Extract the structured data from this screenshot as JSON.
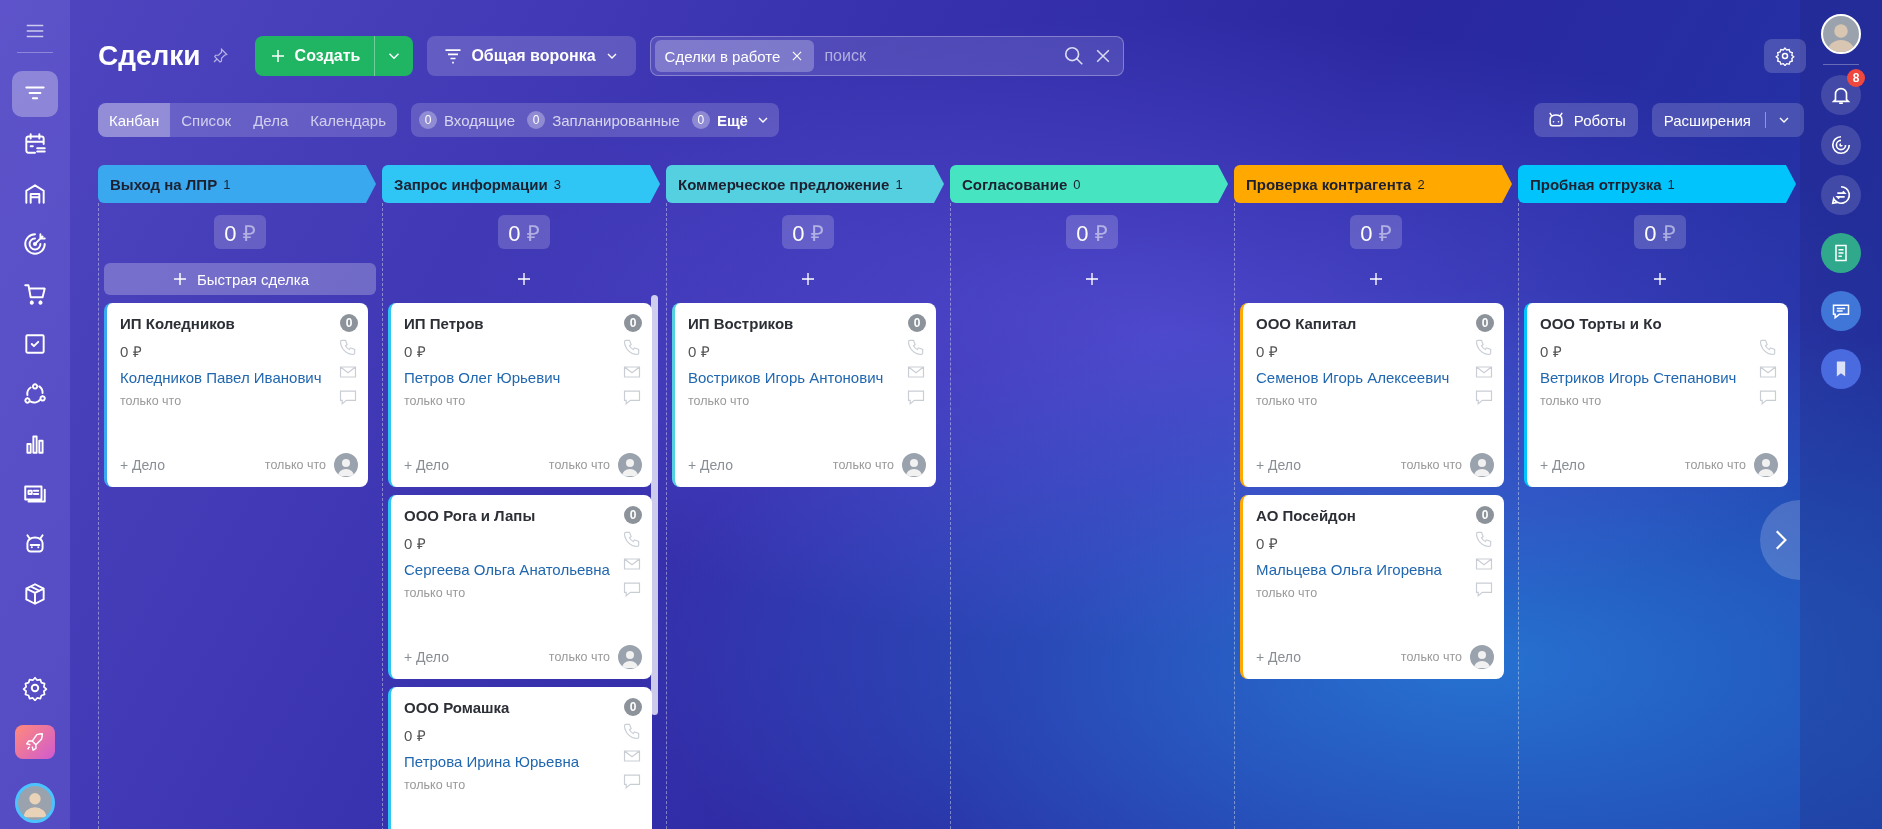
{
  "sidebar": {
    "items": [
      {
        "selected": true
      },
      {
        "selected": false
      },
      {
        "selected": false
      },
      {
        "selected": false
      },
      {
        "selected": false
      },
      {
        "selected": false
      },
      {
        "selected": false
      },
      {
        "selected": false
      },
      {
        "selected": false
      },
      {
        "selected": false
      },
      {
        "selected": false
      }
    ]
  },
  "header": {
    "title": "Сделки",
    "create_button": "Создать",
    "funnel_button": "Общая воронка",
    "search": {
      "filter_tag": "Сделки в работе",
      "placeholder": "поиск"
    }
  },
  "view_tabs": [
    {
      "label": "Канбан",
      "selected": true
    },
    {
      "label": "Список",
      "selected": false
    },
    {
      "label": "Дела",
      "selected": false
    },
    {
      "label": "Календарь",
      "selected": false
    }
  ],
  "counters": [
    {
      "count": "0",
      "label": "Входящие"
    },
    {
      "count": "0",
      "label": "Запланированные"
    },
    {
      "count": "0",
      "label": "Ещё"
    }
  ],
  "robots_button": "Роботы",
  "extensions_button": "Расширения",
  "notifications_badge": "8",
  "columns": [
    {
      "title": "Выход на ЛПР",
      "count": "1",
      "color": "#3aa8ef",
      "sum": "0",
      "currency": "₽",
      "quick_add_label": "Быстрая сделка",
      "cards": [
        {
          "title": "ИП Коледников",
          "counter": "0",
          "amount": "0 ₽",
          "contact": "Коледников Павел Иванович",
          "created": "только что",
          "add_task": "+ Дело",
          "updated": "только что"
        }
      ]
    },
    {
      "title": "Запрос информации",
      "count": "3",
      "color": "#2fc6f6",
      "sum": "0",
      "currency": "₽",
      "cards": [
        {
          "title": "ИП Петров",
          "counter": "0",
          "amount": "0 ₽",
          "contact": "Петров Олег Юрьевич",
          "created": "только что",
          "add_task": "+ Дело",
          "updated": "только что"
        },
        {
          "title": "ООО Рога и Лапы",
          "counter": "0",
          "amount": "0 ₽",
          "contact": "Сергеева Ольга Анатольевна",
          "created": "только что",
          "add_task": "+ Дело",
          "updated": "только что"
        },
        {
          "title": "ООО Ромашка",
          "counter": "0",
          "amount": "0 ₽",
          "contact": "Петрова Ирина Юрьевна",
          "created": "только что"
        }
      ]
    },
    {
      "title": "Коммерческое предложение",
      "count": "1",
      "color": "#55d0e0",
      "sum": "0",
      "currency": "₽",
      "cards": [
        {
          "title": "ИП Востриков",
          "counter": "0",
          "amount": "0 ₽",
          "contact": "Востриков Игорь Антонович",
          "created": "только что",
          "add_task": "+ Дело",
          "updated": "только что"
        }
      ]
    },
    {
      "title": "Согласование",
      "count": "0",
      "color": "#47e4c2",
      "sum": "0",
      "currency": "₽"
    },
    {
      "title": "Проверка контрагента",
      "count": "2",
      "color": "#ffa900",
      "sum": "0",
      "currency": "₽",
      "cards": [
        {
          "title": "ООО Капитал",
          "counter": "0",
          "amount": "0 ₽",
          "contact": "Семенов Игорь Алексеевич",
          "created": "только что",
          "add_task": "+ Дело",
          "updated": "только что"
        },
        {
          "title": "АО Посейдон",
          "counter": "0",
          "amount": "0 ₽",
          "contact": "Мальцева Ольга Игоревна",
          "created": "только что",
          "add_task": "+ Дело",
          "updated": "только что"
        }
      ]
    },
    {
      "title": "Пробная отгрузка",
      "count": "1",
      "color": "#00c4fb",
      "sum": "0",
      "currency": "₽",
      "cards": [
        {
          "title": "ООО Торты и Ко",
          "amount": "0 ₽",
          "contact": "Ветриков Игорь Степанович",
          "created": "только что",
          "add_task": "+ Дело",
          "updated": "только что"
        }
      ]
    }
  ]
}
